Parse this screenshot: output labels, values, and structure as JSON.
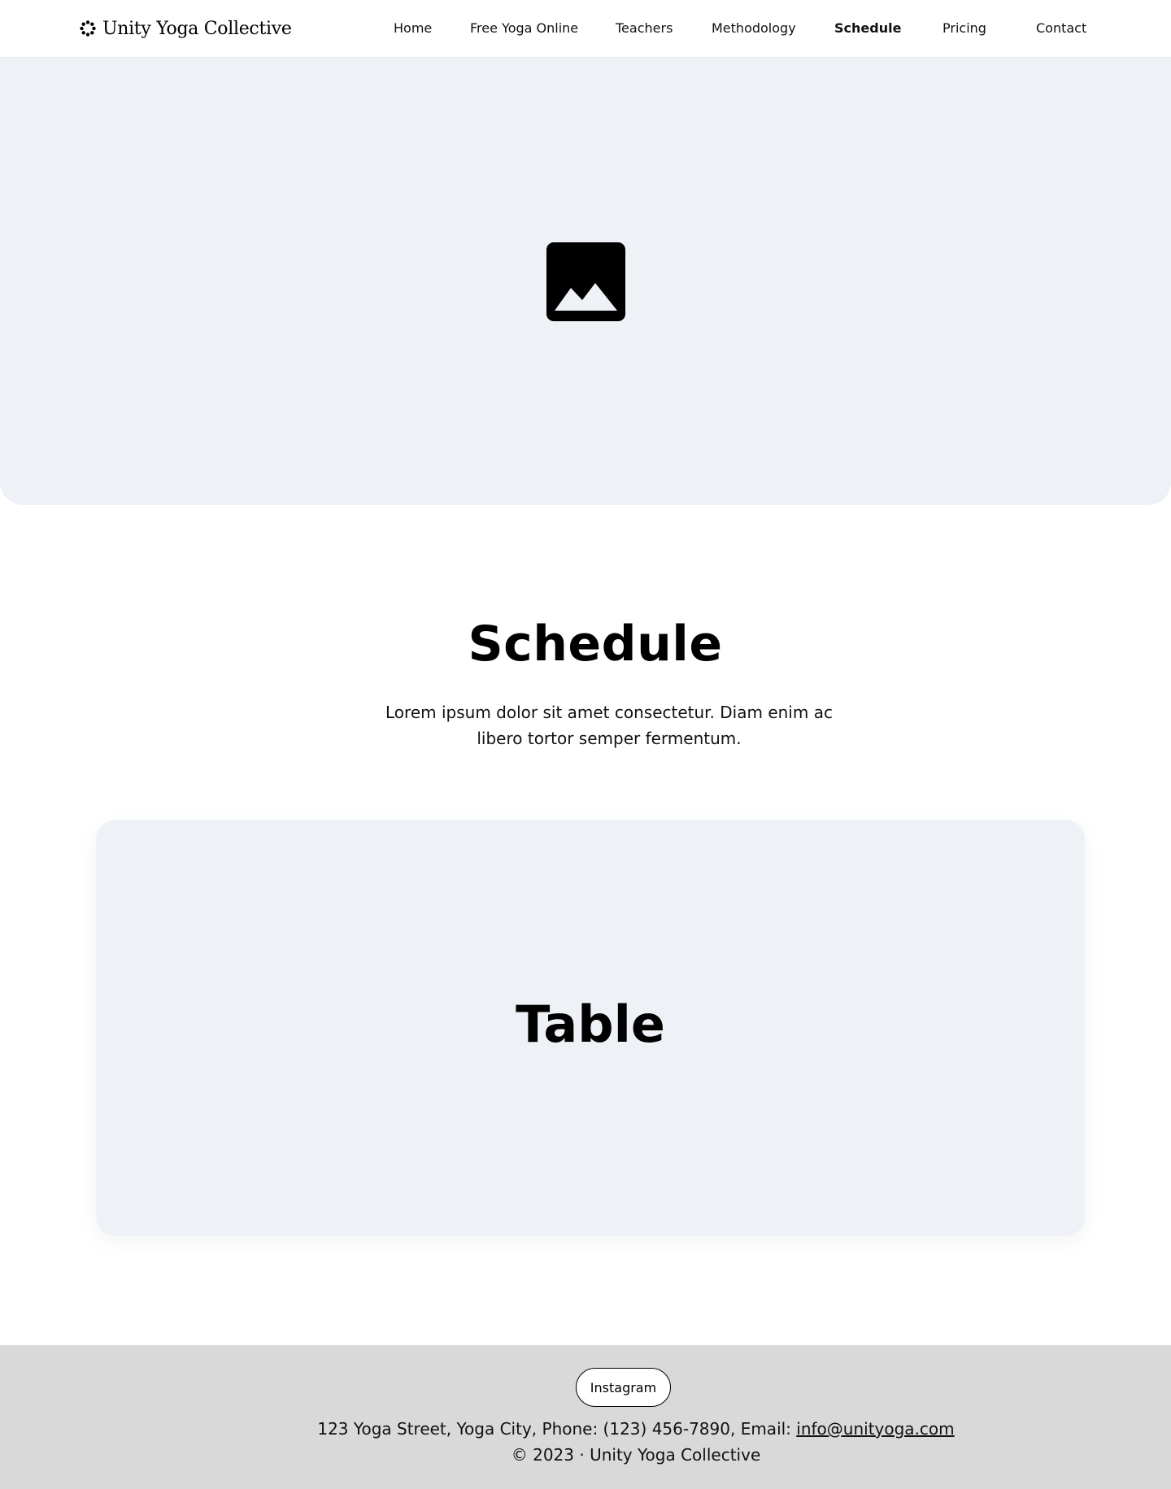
{
  "brand": {
    "name": "Unity Yoga Collective",
    "icon": "flower-dots-icon"
  },
  "nav": {
    "items": [
      {
        "label": "Home",
        "active": false
      },
      {
        "label": "Free Yoga Online",
        "active": false
      },
      {
        "label": "Teachers",
        "active": false
      },
      {
        "label": "Methodology",
        "active": false
      },
      {
        "label": "Schedule",
        "active": true
      },
      {
        "label": "Pricing",
        "active": false
      },
      {
        "label": "Contact",
        "active": false
      }
    ]
  },
  "hero": {
    "icon": "image-placeholder-icon"
  },
  "schedule": {
    "title": "Schedule",
    "subtitle_line1": "Lorem ipsum dolor sit amet consectetur. Diam enim ac",
    "subtitle_line2": "libero tortor semper fermentum.",
    "table_label": "Table"
  },
  "footer": {
    "social_button": "Instagram",
    "address_prefix": "123 Yoga Street, Yoga City, Phone: (123) 456-7890, Email: ",
    "email": "info@unityoga.com",
    "copyright": "© 2023 · Unity Yoga Collective"
  },
  "colors": {
    "placeholder_bg": "#eef1f6",
    "footer_bg": "#d9d9d9",
    "text": "#000000"
  }
}
